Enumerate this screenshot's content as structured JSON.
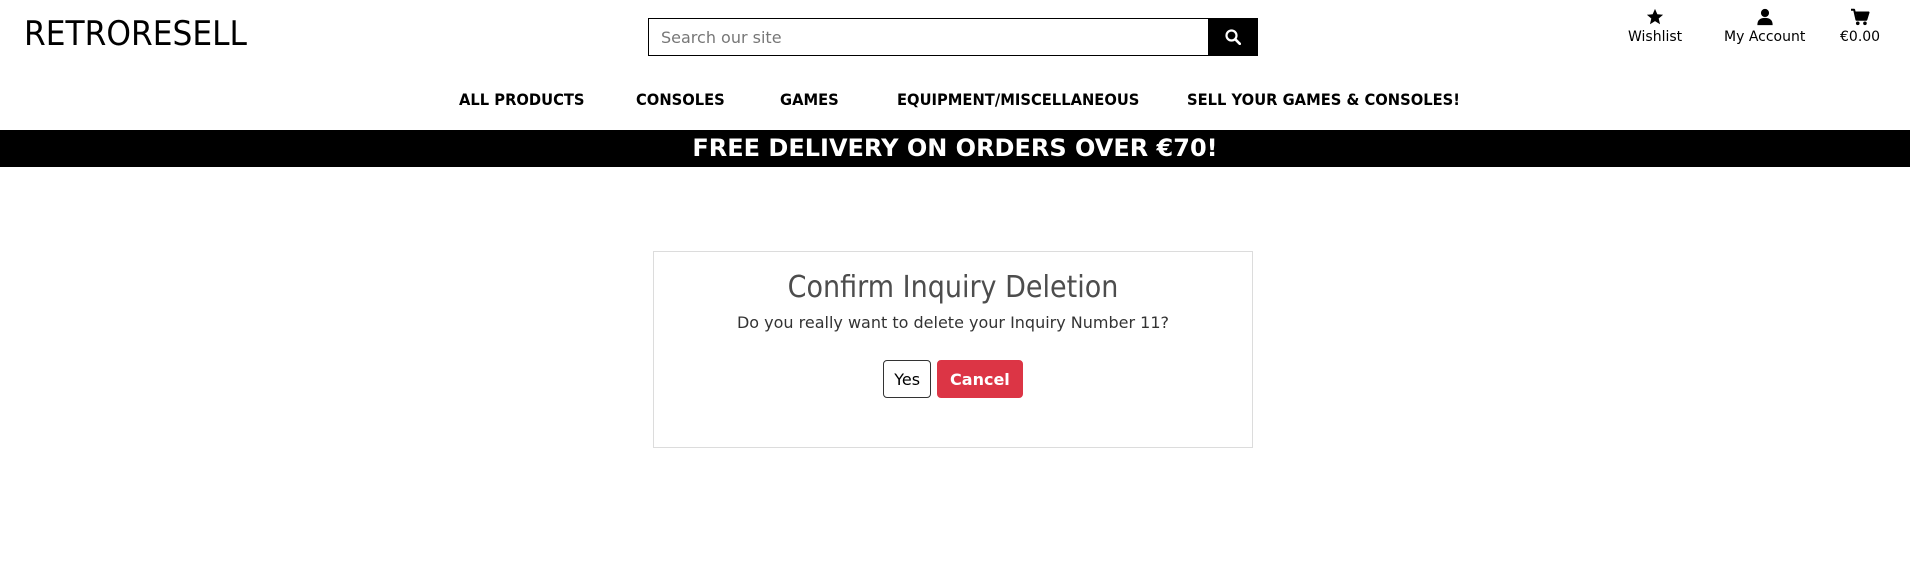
{
  "header": {
    "logo": "RETRORESELL",
    "search": {
      "placeholder": "Search our site",
      "icon": "search-icon"
    },
    "account_links": [
      {
        "label": "Wishlist",
        "icon": "star-icon"
      },
      {
        "label": "My Account",
        "icon": "user-icon"
      },
      {
        "label": "€0.00",
        "icon": "cart-icon"
      }
    ]
  },
  "nav": {
    "items": [
      "ALL PRODUCTS",
      "CONSOLES",
      "GAMES",
      "EQUIPMENT/MISCELLANEOUS",
      "SELL YOUR GAMES & CONSOLES!"
    ]
  },
  "banner": {
    "text": "FREE DELIVERY ON ORDERS OVER €70!"
  },
  "dialog": {
    "title": "Confirm Inquiry Deletion",
    "message": "Do you really want to delete your Inquiry Number 11?",
    "yes_label": "Yes",
    "cancel_label": "Cancel"
  },
  "colors": {
    "banner_bg": "#000000",
    "cancel_bg": "#dc3545",
    "title_text": "#4d4d4d"
  }
}
